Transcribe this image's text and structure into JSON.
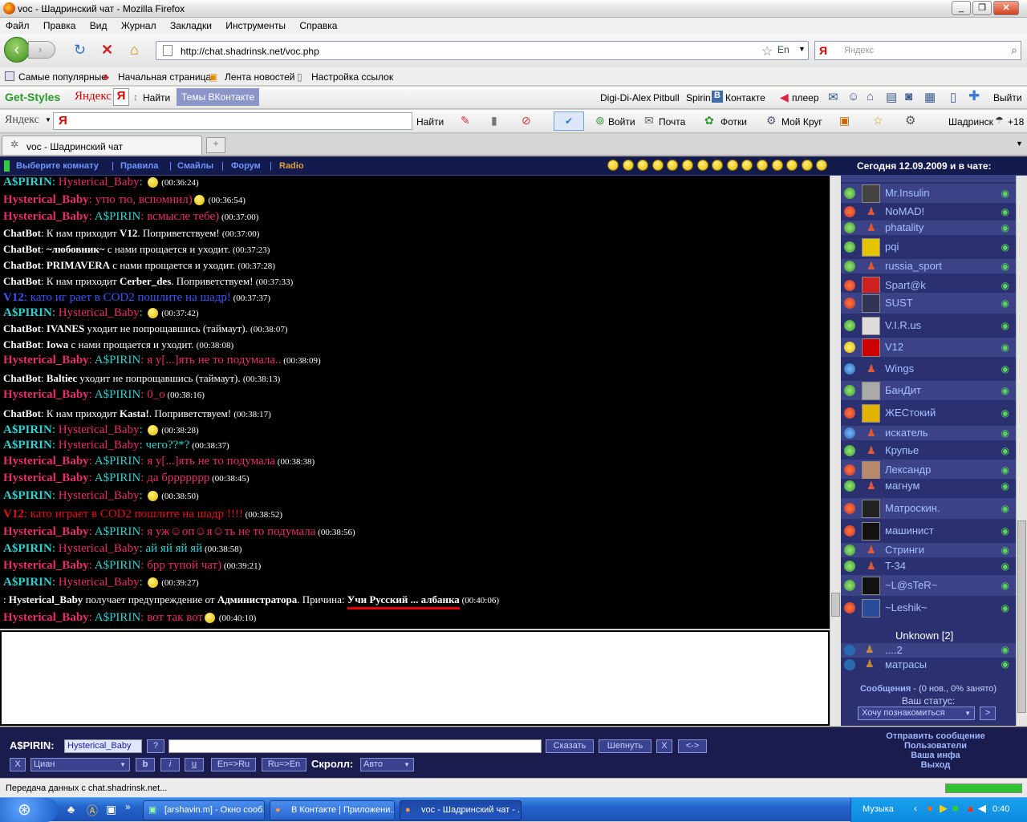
{
  "window": {
    "title": "voc - Шадринский чат - Mozilla Firefox"
  },
  "menu": [
    "Файл",
    "Правка",
    "Вид",
    "Журнал",
    "Закладки",
    "Инструменты",
    "Справка"
  ],
  "nav": {
    "url": "http://chat.shadrinsk.net/voc.php",
    "lang": "En",
    "search_placeholder": "Яндекс"
  },
  "bookmarks": [
    "Самые популярные",
    "Начальная страница",
    "Лента новостей",
    "Настройка ссылок"
  ],
  "toolbar1": {
    "brand": "Get-Styles",
    "yandex": "Яндекс",
    "ya": "Я",
    "find": "Найти",
    "vk_themes": "Темы ВКонтакте",
    "digi": "Digi-Di-Alex",
    "pitbull": "Pitbull",
    "spirin": "Spirin",
    "vk": "Контакте",
    "player": "плеер",
    "exit": "Выйти"
  },
  "toolbar2": {
    "yandex": "Яндекс",
    "find": "Найти",
    "login": "Войти",
    "mail": "Почта",
    "photos": "Фотки",
    "circle": "Мой Круг",
    "city": "Шадринск",
    "temp": "+18"
  },
  "tab": {
    "label": "voc - Шадринский чат"
  },
  "chatnav": {
    "links": [
      "Выберите комнату",
      "Правила",
      "Смайлы",
      "Форум",
      "Radio"
    ],
    "date": "Сегодня 12.09.2009 и в чате:"
  },
  "messages": [
    {
      "type": "user",
      "from": "A$PIRIN",
      "fromColor": "sa",
      "to": "Hysterical_Baby",
      "toColor": "sb",
      "text": "",
      "icon": true,
      "time": "(00:36:24)"
    },
    {
      "type": "user",
      "from": "Hysterical_Baby",
      "fromColor": "sb",
      "to": "",
      "text": "утю тю, вспомнил)",
      "icon": true,
      "time": "(00:36:54)"
    },
    {
      "type": "user",
      "from": "Hysterical_Baby",
      "fromColor": "sb",
      "to": "A$PIRIN",
      "toColor": "sa",
      "text": "всмысле тебе)",
      "time": "(00:37:00)"
    },
    {
      "type": "bot",
      "parts": [
        [
          "ChatBot",
          1
        ],
        [
          ": К нам приходит ",
          0
        ],
        [
          "V12",
          1
        ],
        [
          ". Поприветствуем! ",
          0
        ]
      ],
      "time": "(00:37:00)"
    },
    {
      "type": "bot",
      "parts": [
        [
          "ChatBot",
          1
        ],
        [
          ": ",
          0
        ],
        [
          "~любовник~",
          1
        ],
        [
          " с нами прощается и уходит. ",
          0
        ]
      ],
      "time": "(00:37:23)"
    },
    {
      "type": "bot",
      "parts": [
        [
          "ChatBot",
          1
        ],
        [
          ": ",
          0
        ],
        [
          "PRIMAVERA",
          1
        ],
        [
          " с нами прощается и уходит. ",
          0
        ]
      ],
      "time": "(00:37:28)"
    },
    {
      "type": "bot",
      "parts": [
        [
          "ChatBot",
          1
        ],
        [
          ": К нам приходит ",
          0
        ],
        [
          "Cerber_des",
          1
        ],
        [
          ". Поприветствуем! ",
          0
        ]
      ],
      "time": "(00:37:33)"
    },
    {
      "type": "user",
      "from": "V12",
      "fromColor": "sv",
      "to": "",
      "text": "като иг рает в COD2 пошлите на шадр!",
      "time": "(00:37:37)"
    },
    {
      "type": "user",
      "from": "A$PIRIN",
      "fromColor": "sa",
      "to": "Hysterical_Baby",
      "toColor": "sb",
      "text": "",
      "icon": true,
      "time": "(00:37:42)"
    },
    {
      "type": "bot",
      "parts": [
        [
          "ChatBot",
          1
        ],
        [
          ": ",
          0
        ],
        [
          "IVANES",
          1
        ],
        [
          " уходит не попрощавшись (таймаут). ",
          0
        ]
      ],
      "time": "(00:38:07)"
    },
    {
      "type": "bot",
      "parts": [
        [
          "ChatBot",
          1
        ],
        [
          ": ",
          0
        ],
        [
          "Iowa",
          1
        ],
        [
          " с нами прощается и уходит. ",
          0
        ]
      ],
      "time": "(00:38:08)"
    },
    {
      "type": "user",
      "from": "Hysterical_Baby",
      "fromColor": "sb",
      "to": "A$PIRIN",
      "toColor": "sa",
      "text": "я у[...]ять не то подумала..",
      "time": "(00:38:09)"
    },
    {
      "type": "bot",
      "parts": [
        [
          "ChatBot",
          1
        ],
        [
          ": ",
          0
        ],
        [
          "Baltiec",
          1
        ],
        [
          " уходит не попрощавшись (таймаут). ",
          0
        ]
      ],
      "time": "(00:38:13)"
    },
    {
      "type": "user",
      "from": "Hysterical_Baby",
      "fromColor": "sb",
      "to": "A$PIRIN",
      "toColor": "sa",
      "text": "0_o",
      "time": "(00:38:16)"
    },
    {
      "type": "bot",
      "parts": [
        [
          "ChatBot",
          1
        ],
        [
          ": К нам приходит ",
          0
        ],
        [
          "Kasta!",
          1
        ],
        [
          ". Поприветствуем! ",
          0
        ]
      ],
      "time": "(00:38:17)"
    },
    {
      "type": "user",
      "from": "A$PIRIN",
      "fromColor": "sa",
      "to": "Hysterical_Baby",
      "toColor": "sb",
      "text": "",
      "icon": true,
      "time": "(00:38:28)"
    },
    {
      "type": "user",
      "from": "A$PIRIN",
      "fromColor": "sa",
      "to": "Hysterical_Baby",
      "toColor": "sb",
      "text": "чего??*?",
      "time": "(00:38:37)"
    },
    {
      "type": "user",
      "from": "Hysterical_Baby",
      "fromColor": "sb",
      "to": "A$PIRIN",
      "toColor": "sa",
      "text": "я у[...]ять не то подумала",
      "time": "(00:38:38)"
    },
    {
      "type": "user",
      "from": "Hysterical_Baby",
      "fromColor": "sb",
      "to": "A$PIRIN",
      "toColor": "sa",
      "text": "да бррррррр",
      "time": "(00:38:45)"
    },
    {
      "type": "user",
      "from": "A$PIRIN",
      "fromColor": "sa",
      "to": "Hysterical_Baby",
      "toColor": "sb",
      "text": "",
      "icon": true,
      "time": "(00:38:50)"
    },
    {
      "type": "user",
      "from": "V12",
      "fromColor": "sr",
      "to": "",
      "text": "като играет в COD2 пошлите на шадр !!!!",
      "time": "(00:38:52)"
    },
    {
      "type": "user",
      "from": "Hysterical_Baby",
      "fromColor": "sb",
      "to": "A$PIRIN",
      "toColor": "sa",
      "text": "я уж☺оп☺я☺ть не то подумала",
      "time": "(00:38:56)"
    },
    {
      "type": "user",
      "from": "A$PIRIN",
      "fromColor": "sa",
      "to": "Hysterical_Baby",
      "toColor": "sb",
      "text": "ай яй яй яй",
      "time": "(00:38:58)"
    },
    {
      "type": "user",
      "from": "Hysterical_Baby",
      "fromColor": "sb",
      "to": "A$PIRIN",
      "toColor": "sa",
      "text": "брр тупой чат)",
      "time": "(00:39:21)"
    },
    {
      "type": "user",
      "from": "A$PIRIN",
      "fromColor": "sa",
      "to": "Hysterical_Baby",
      "toColor": "sb",
      "text": "",
      "icon": true,
      "time": "(00:39:27)"
    },
    {
      "type": "warn",
      "parts": [
        [
          ": ",
          0
        ],
        [
          "Hysterical_Baby",
          1
        ],
        [
          " получает предупреждение от ",
          0
        ],
        [
          "Администратора",
          1
        ],
        [
          ". Причина: ",
          0
        ],
        [
          "Учи Русский ... албанка",
          2
        ]
      ],
      "time": "(00:40:06)"
    },
    {
      "type": "user",
      "from": "Hysterical_Baby",
      "fromColor": "sb",
      "to": "A$PIRIN",
      "toColor": "sa",
      "text": "вот так вот",
      "icon": true,
      "time": "(00:40:10)"
    }
  ],
  "users": [
    {
      "name": "Mr.Insulin",
      "ava": "#444"
    },
    {
      "name": "NoMAD!",
      "ava": ""
    },
    {
      "name": "phatality",
      "ava": ""
    },
    {
      "name": "pqi",
      "ava": "#e6c300"
    },
    {
      "name": "russia_sport",
      "ava": ""
    },
    {
      "name": "Spart@k",
      "ava": "#c22"
    },
    {
      "name": "SUST",
      "ava": "#335"
    },
    {
      "name": "V.I.R.us",
      "ava": "#ddd"
    },
    {
      "name": "V12",
      "ava": "#c00"
    },
    {
      "name": "Wings",
      "ava": ""
    },
    {
      "name": "БанДит",
      "ava": "#aaa"
    },
    {
      "name": "ЖЕСтокий",
      "ava": "#e2b400"
    },
    {
      "name": "искатель",
      "ava": ""
    },
    {
      "name": "Крупье",
      "ava": ""
    },
    {
      "name": "Лександр",
      "ava": "#b98a6a"
    },
    {
      "name": "магнум",
      "ava": ""
    },
    {
      "name": "Матроскин.",
      "ava": "#222"
    },
    {
      "name": "машинист",
      "ava": "#111"
    },
    {
      "name": "Стринги",
      "ava": ""
    },
    {
      "name": "T-34",
      "ava": ""
    },
    {
      "name": "~L@sTeR~",
      "ava": "#111"
    },
    {
      "name": "~Leshik~",
      "ava": "#2a4c9a"
    }
  ],
  "unknown": {
    "label": "Unknown [2]",
    "items": [
      "....2",
      "матрасы"
    ]
  },
  "sidebar_footer": {
    "messages": "Сообщения",
    "messages_info": " - (0 нов., 0% занято)",
    "status_label": "Ваш статус:",
    "status_value": "Хочу познакомиться",
    "go": ">"
  },
  "bottom": {
    "nick": "A$PIRIN:",
    "to_value": "Hysterical_Baby",
    "q": "?",
    "say": "Сказать",
    "whisper": "Шепнуть",
    "x": "X",
    "arrows": "<->",
    "x2": "X",
    "color": "Циан",
    "b": "b",
    "i": "i",
    "u": "u",
    "enru": "En=>Ru",
    "ruen": "Ru=>En",
    "scroll_label": "Скролл:",
    "scroll_value": "Авто"
  },
  "right_links": [
    "Отправить сообщение",
    "Пользователи",
    "Ваша инфа",
    "Выход"
  ],
  "status": {
    "text": "Передача данных с chat.shadrinsk.net..."
  },
  "taskbar": {
    "tasks": [
      "[arshavin.m] - Окно сооб...",
      "В Контакте | Приложени...",
      "voc - Шадринский чат - ..."
    ],
    "music": "Музыка",
    "clock": "0:40"
  }
}
